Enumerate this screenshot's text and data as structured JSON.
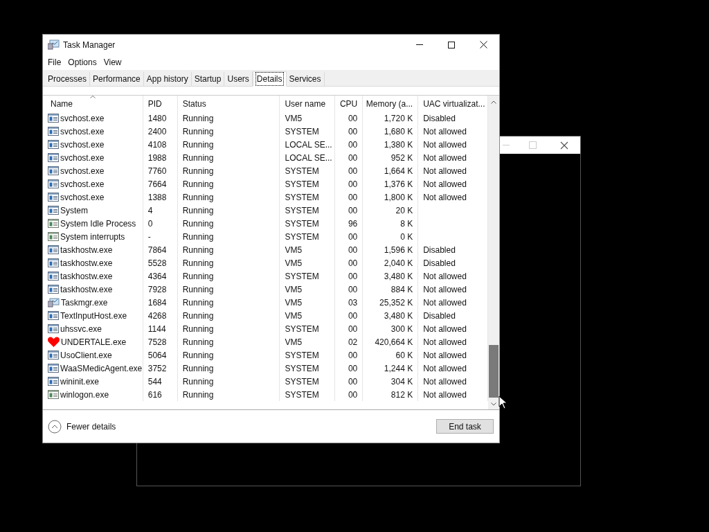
{
  "window": {
    "title": "Task Manager"
  },
  "menu": [
    "File",
    "Options",
    "View"
  ],
  "tabs": [
    {
      "label": "Processes",
      "selected": false
    },
    {
      "label": "Performance",
      "selected": false
    },
    {
      "label": "App history",
      "selected": false
    },
    {
      "label": "Startup",
      "selected": false
    },
    {
      "label": "Users",
      "selected": false
    },
    {
      "label": "Details",
      "selected": true
    },
    {
      "label": "Services",
      "selected": false
    }
  ],
  "table": {
    "columns": [
      {
        "label": "Name",
        "sorted": true
      },
      {
        "label": "PID",
        "sorted": false
      },
      {
        "label": "Status",
        "sorted": false
      },
      {
        "label": "User name",
        "sorted": false
      },
      {
        "label": "CPU",
        "sorted": false
      },
      {
        "label": "Memory (a...",
        "sorted": false
      },
      {
        "label": "UAC virtualizat...",
        "sorted": false
      }
    ],
    "rows": [
      {
        "kind": "app",
        "name": "svchost.exe",
        "pid": "1480",
        "status": "Running",
        "user": "VM5",
        "cpu": "00",
        "memory": "1,720 K",
        "uac": "Disabled"
      },
      {
        "kind": "app",
        "name": "svchost.exe",
        "pid": "2400",
        "status": "Running",
        "user": "SYSTEM",
        "cpu": "00",
        "memory": "1,680 K",
        "uac": "Not allowed"
      },
      {
        "kind": "app",
        "name": "svchost.exe",
        "pid": "4108",
        "status": "Running",
        "user": "LOCAL SE...",
        "cpu": "00",
        "memory": "1,380 K",
        "uac": "Not allowed"
      },
      {
        "kind": "app",
        "name": "svchost.exe",
        "pid": "1988",
        "status": "Running",
        "user": "LOCAL SE...",
        "cpu": "00",
        "memory": "952 K",
        "uac": "Not allowed"
      },
      {
        "kind": "app",
        "name": "svchost.exe",
        "pid": "7760",
        "status": "Running",
        "user": "SYSTEM",
        "cpu": "00",
        "memory": "1,664 K",
        "uac": "Not allowed"
      },
      {
        "kind": "app",
        "name": "svchost.exe",
        "pid": "7664",
        "status": "Running",
        "user": "SYSTEM",
        "cpu": "00",
        "memory": "1,376 K",
        "uac": "Not allowed"
      },
      {
        "kind": "app",
        "name": "svchost.exe",
        "pid": "1388",
        "status": "Running",
        "user": "SYSTEM",
        "cpu": "00",
        "memory": "1,800 K",
        "uac": "Not allowed"
      },
      {
        "kind": "app",
        "name": "System",
        "pid": "4",
        "status": "Running",
        "user": "SYSTEM",
        "cpu": "00",
        "memory": "20 K"
      },
      {
        "kind": "system",
        "name": "System Idle Process",
        "pid": "0",
        "status": "Running",
        "user": "SYSTEM",
        "cpu": "96",
        "memory": "8 K"
      },
      {
        "kind": "system",
        "name": "System interrupts",
        "pid": "-",
        "status": "Running",
        "user": "SYSTEM",
        "cpu": "00",
        "memory": "0 K"
      },
      {
        "kind": "app",
        "name": "taskhostw.exe",
        "pid": "7864",
        "status": "Running",
        "user": "VM5",
        "cpu": "00",
        "memory": "1,596 K",
        "uac": "Disabled"
      },
      {
        "kind": "app",
        "name": "taskhostw.exe",
        "pid": "5528",
        "status": "Running",
        "user": "VM5",
        "cpu": "00",
        "memory": "2,040 K",
        "uac": "Disabled"
      },
      {
        "kind": "app",
        "name": "taskhostw.exe",
        "pid": "4364",
        "status": "Running",
        "user": "SYSTEM",
        "cpu": "00",
        "memory": "3,480 K",
        "uac": "Not allowed"
      },
      {
        "kind": "app",
        "name": "taskhostw.exe",
        "pid": "7928",
        "status": "Running",
        "user": "VM5",
        "cpu": "00",
        "memory": "884 K",
        "uac": "Not allowed"
      },
      {
        "kind": "monitor",
        "name": "Taskmgr.exe",
        "pid": "1684",
        "status": "Running",
        "user": "VM5",
        "cpu": "03",
        "memory": "25,352 K",
        "uac": "Not allowed"
      },
      {
        "kind": "app",
        "name": "TextInputHost.exe",
        "pid": "4268",
        "status": "Running",
        "user": "VM5",
        "cpu": "00",
        "memory": "3,480 K",
        "uac": "Disabled"
      },
      {
        "kind": "app",
        "name": "uhssvc.exe",
        "pid": "1144",
        "status": "Running",
        "user": "SYSTEM",
        "cpu": "00",
        "memory": "300 K",
        "uac": "Not allowed"
      },
      {
        "kind": "heart",
        "name": "UNDERTALE.exe",
        "pid": "7528",
        "status": "Running",
        "user": "VM5",
        "cpu": "02",
        "memory": "420,664 K",
        "uac": "Not allowed"
      },
      {
        "kind": "app",
        "name": "UsoClient.exe",
        "pid": "5064",
        "status": "Running",
        "user": "SYSTEM",
        "cpu": "00",
        "memory": "60 K",
        "uac": "Not allowed"
      },
      {
        "kind": "app",
        "name": "WaaSMedicAgent.exe",
        "pid": "3752",
        "status": "Running",
        "user": "SYSTEM",
        "cpu": "00",
        "memory": "1,244 K",
        "uac": "Not allowed"
      },
      {
        "kind": "app",
        "name": "wininit.exe",
        "pid": "544",
        "status": "Running",
        "user": "SYSTEM",
        "cpu": "00",
        "memory": "304 K",
        "uac": "Not allowed"
      },
      {
        "kind": "system",
        "name": "winlogon.exe",
        "pid": "616",
        "status": "Running",
        "user": "SYSTEM",
        "cpu": "00",
        "memory": "812 K",
        "uac": "Not allowed"
      }
    ]
  },
  "footer": {
    "details_toggle": "Fewer details",
    "button": "End task"
  }
}
